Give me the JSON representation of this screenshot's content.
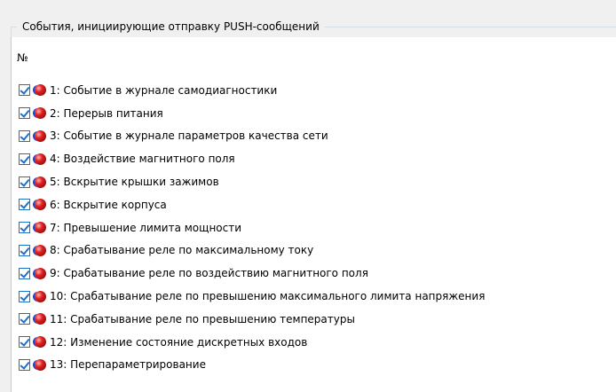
{
  "group": {
    "title": "События, инициирующие отправку PUSH-сообщений",
    "column_header": "№"
  },
  "icons": {
    "checkbox": "checkbox-checked-icon",
    "event": "red-blue-ball-icon"
  },
  "colors": {
    "checkbox_border": "#1e71c7",
    "ball_red": "#e12020",
    "ball_blue": "#1d44c8"
  },
  "events": [
    {
      "label": "1: Событие в журнале самодиагностики",
      "checked": true
    },
    {
      "label": "2: Перерыв питания",
      "checked": true
    },
    {
      "label": "3: Событие в журнале параметров качества сети",
      "checked": true
    },
    {
      "label": "4: Воздействие магнитного поля",
      "checked": true
    },
    {
      "label": "5: Вскрытие крышки зажимов",
      "checked": true
    },
    {
      "label": "6: Вскрытие корпуса",
      "checked": true
    },
    {
      "label": "7: Превышение лимита мощности",
      "checked": true
    },
    {
      "label": "8: Срабатывание реле по максимальному току",
      "checked": true
    },
    {
      "label": "9: Срабатывание реле по воздействию магнитного поля",
      "checked": true
    },
    {
      "label": "10: Срабатывание реле по превышению максимального лимита напряжения",
      "checked": true
    },
    {
      "label": "11: Срабатывание реле по превышению температуры",
      "checked": true
    },
    {
      "label": "12: Изменение состояние дискретных входов",
      "checked": true
    },
    {
      "label": "13: Перепараметрирование",
      "checked": true
    }
  ]
}
